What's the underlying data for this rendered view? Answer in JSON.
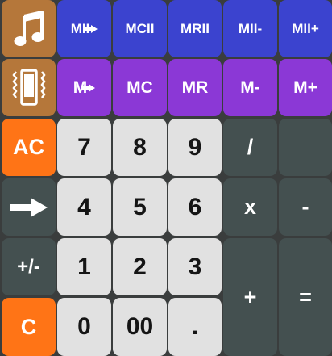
{
  "memory_row_2": [
    "MII",
    "MCII",
    "MRII",
    "MII-",
    "MII+"
  ],
  "memory_row_1": [
    "M",
    "MC",
    "MR",
    "M-",
    "M+"
  ],
  "icons": {
    "music": "music-note-icon",
    "vibrate": "phone-vibrate-icon",
    "arrow": "arrow-right-icon"
  },
  "keys": {
    "ac": "AC",
    "plus_minus": "+/-",
    "clear": "C",
    "divide": "/",
    "multiply": "x",
    "minus": "-",
    "plus": "+",
    "equals": "=",
    "seven": "7",
    "eight": "8",
    "nine": "9",
    "four": "4",
    "five": "5",
    "six": "6",
    "one": "1",
    "two": "2",
    "three": "3",
    "zero": "0",
    "double_zero": "00",
    "decimal": "."
  },
  "colors": {
    "memory_secondary": "#3b43cf",
    "memory_primary": "#8b38d6",
    "utility": "#b5773a",
    "clear": "#ff7416",
    "operator": "#445050",
    "digit": "#e1e1e1"
  }
}
